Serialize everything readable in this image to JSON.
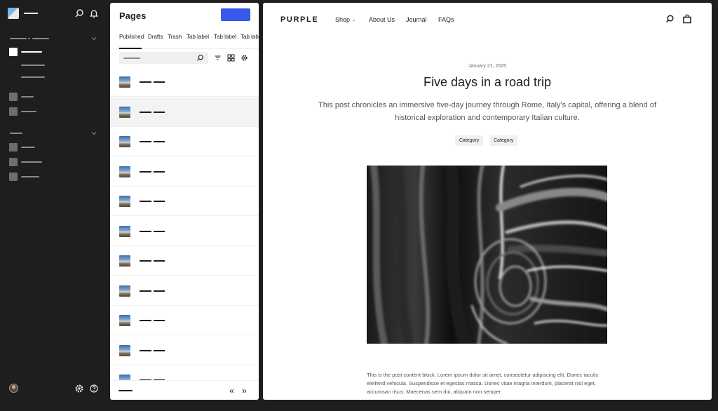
{
  "panel": {
    "title": "Pages",
    "tabs": [
      "Published",
      "Drafts",
      "Trash",
      "Tab label",
      "Tab label",
      "Tab label"
    ],
    "active_tab": "Published",
    "row_count": 11,
    "selected_row": 1,
    "pager_first": "«",
    "pager_next": "»"
  },
  "preview": {
    "brand": "PURPLE",
    "nav": [
      "Shop",
      "About Us",
      "Journal",
      "FAQs"
    ],
    "nav_caret": "⌄",
    "post": {
      "date": "January 21, 2025",
      "title": "Five days in a road trip",
      "excerpt": "This post chronicles an immersive five-day journey through Rome, Italy’s capital, offering a blend of historical exploration and contemporary Italian culture.",
      "categories": [
        "Category",
        "Category"
      ],
      "body": "This is the post content block. Lorem ipsum dolor sit amet, consectetur adipiscing elit. Donec iaculis eleifend vehicula. Suspendisse et egestas massa. Donec vitae magna interdum, placerat nisl eget, accumsan risus. Maecenas sem dui, aliquam non semper"
    }
  },
  "colors": {
    "sidebar_bg": "#1e1e1e",
    "accent": "#3858e9",
    "text": "#1e1e1e",
    "muted": "#555555"
  },
  "icons": {
    "sidebar": [
      "site-logo-icon",
      "search-icon",
      "bell-icon",
      "gear-icon",
      "help-icon",
      "avatar"
    ],
    "panel": [
      "search-icon",
      "filter-icon",
      "grid-view-icon",
      "gear-icon"
    ],
    "preview": [
      "search-icon",
      "cart-icon"
    ]
  }
}
